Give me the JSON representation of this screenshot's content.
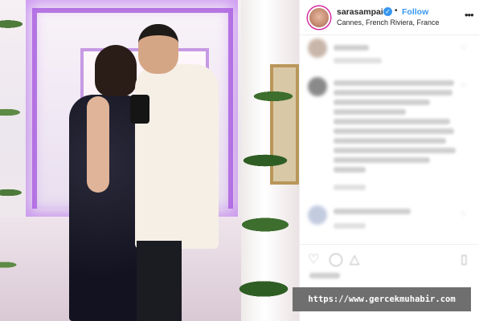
{
  "post": {
    "username": "sarasampaio",
    "verified_icon": "verified-badge-icon",
    "separator": "•",
    "follow_label": "Follow",
    "location": "Cannes, French Riviera, France",
    "more_icon": "more-options-icon"
  },
  "actions": {
    "like_icon": "heart-icon",
    "comment_icon": "comment-icon",
    "share_icon": "share-icon",
    "save_icon": "bookmark-icon"
  },
  "watermark": {
    "text": "https://www.gercekmuhabir.com"
  },
  "colors": {
    "link_blue": "#3897f0",
    "verified_blue": "#3897f0",
    "watermark_bg": "#6f6f6f"
  }
}
